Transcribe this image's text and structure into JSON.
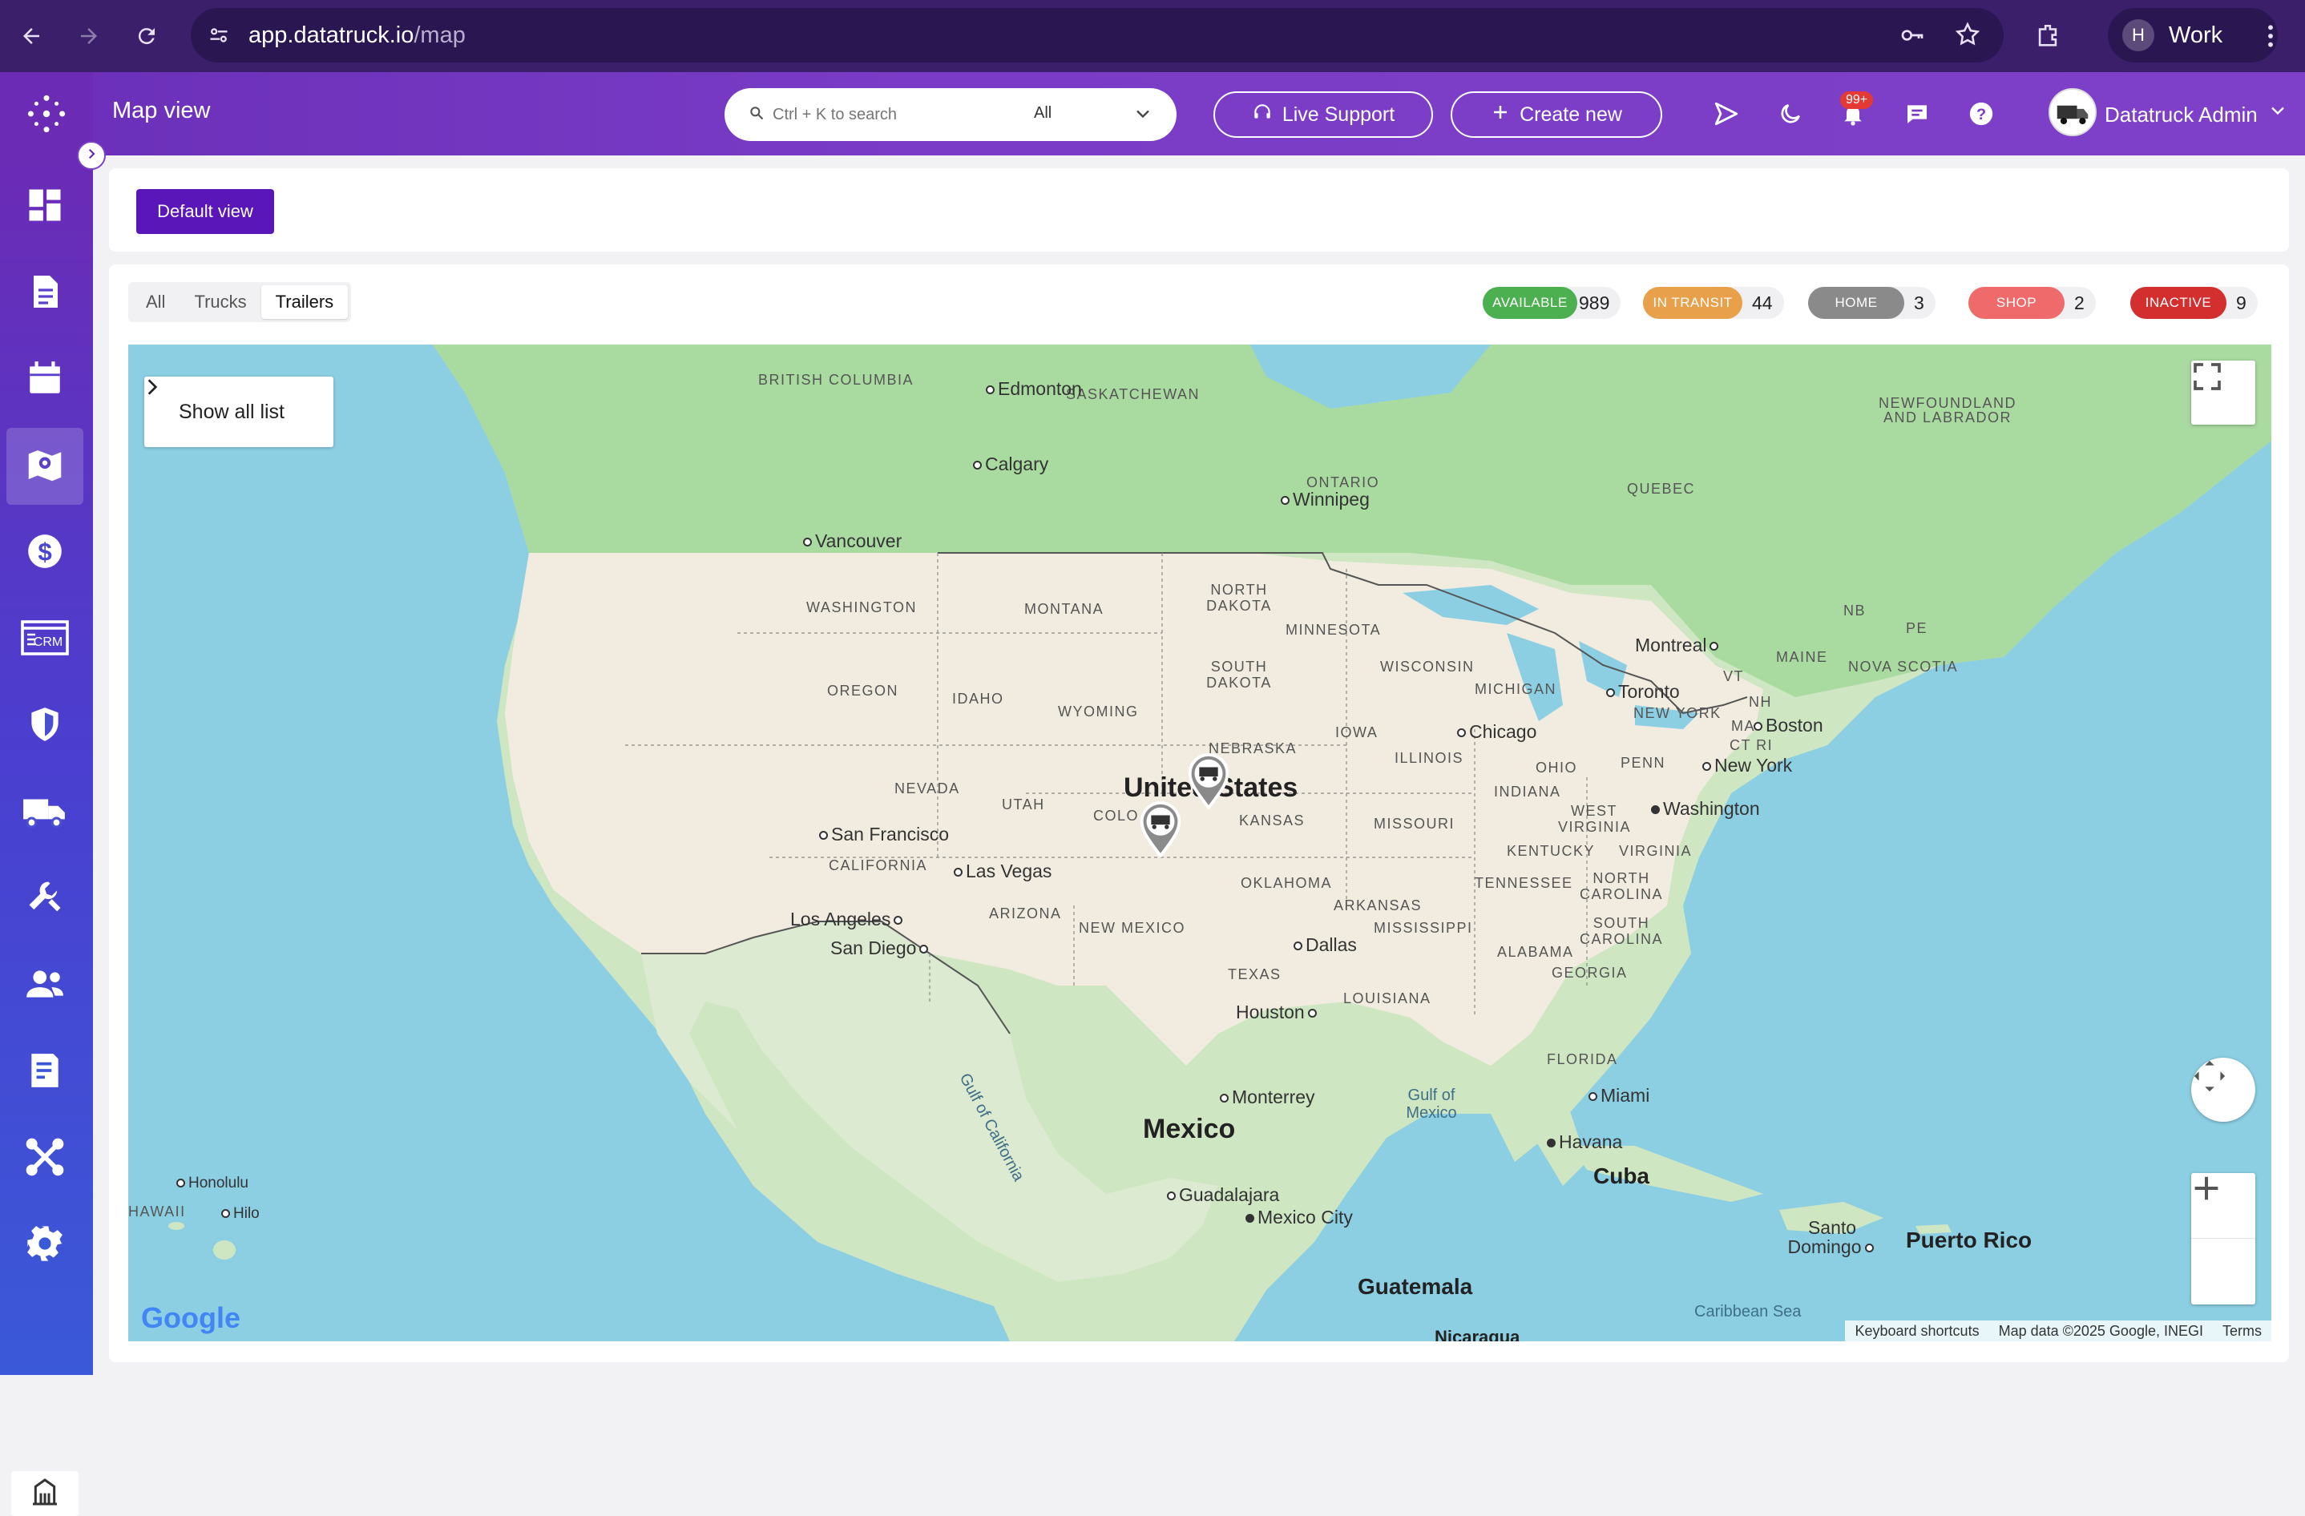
{
  "browser": {
    "url_host": "app.datatruck.io",
    "url_path": "/map",
    "profile_initial": "H",
    "profile_name": "Work"
  },
  "header": {
    "page_title": "Map view",
    "search_placeholder": "Ctrl + K to search",
    "search_scope": "All",
    "live_support": "Live Support",
    "create_new": "Create new",
    "notification_count": "99+",
    "user_name": "Datatruck Admin"
  },
  "sidebar": {
    "items": [
      "dashboard-icon",
      "document-icon",
      "calendar-icon",
      "map-icon",
      "dollar-icon",
      "crm-icon",
      "shield-icon",
      "truck-icon",
      "tools-icon",
      "users-icon",
      "report-icon",
      "integrations-icon",
      "settings-icon"
    ],
    "active": "map-icon",
    "crm_text": "CRM"
  },
  "toolbar": {
    "default_view": "Default view"
  },
  "tabs": [
    {
      "label": "All",
      "active": false
    },
    {
      "label": "Trucks",
      "active": false
    },
    {
      "label": "Trailers",
      "active": true
    }
  ],
  "statuses": [
    {
      "label": "AVAILABLE",
      "count": "989",
      "color": "#4caf50"
    },
    {
      "label": "IN TRANSIT",
      "count": "44",
      "color": "#e8a04a"
    },
    {
      "label": "HOME",
      "count": "3",
      "color": "#8a8a8a"
    },
    {
      "label": "SHOP",
      "count": "2",
      "color": "#ef6b6b"
    },
    {
      "label": "INACTIVE",
      "count": "9",
      "color": "#d32f2f"
    }
  ],
  "map": {
    "show_all_list": "Show all list",
    "google": "Google",
    "footer": [
      "Keyboard shortcuts",
      "Map data ©2025 Google, INEGI",
      "Terms"
    ],
    "regions": [
      "BRITISH COLUMBIA",
      "SASKATCHEWAN",
      "NEWFOUNDLAND AND LABRADOR",
      "ONTARIO",
      "QUEBEC",
      "WASHINGTON",
      "MONTANA",
      "NORTH DAKOTA",
      "MINNESOTA",
      "OREGON",
      "IDAHO",
      "WYOMING",
      "SOUTH DAKOTA",
      "WISCONSIN",
      "MICHIGAN",
      "NEBRASKA",
      "IOWA",
      "ILLINOIS",
      "OHIO",
      "PENN",
      "NEVADA",
      "UTAH",
      "COLO",
      "KANSAS",
      "MISSOURI",
      "INDIANA",
      "WEST VIRGINIA",
      "VIRGINIA",
      "KENTUCKY",
      "CALIFORNIA",
      "ARIZONA",
      "NEW MEXICO",
      "OKLAHOMA",
      "ARKANSAS",
      "TENNESSEE",
      "NORTH CAROLINA",
      "MISSISSIPPI",
      "ALABAMA",
      "SOUTH CAROLINA",
      "GEORGIA",
      "TEXAS",
      "LOUISIANA",
      "FLORIDA",
      "MAINE",
      "NB",
      "PE",
      "NOVA SCOTIA",
      "VT",
      "NH",
      "MA",
      "CT RI",
      "NEW YORK",
      "HAWAII"
    ],
    "cities": [
      "Edmonton",
      "Calgary",
      "Winnipeg",
      "Vancouver",
      "Montreal",
      "Toronto",
      "Boston",
      "New York",
      "Chicago",
      "Washington",
      "San Francisco",
      "Las Vegas",
      "Los Angeles",
      "San Diego",
      "Dallas",
      "Houston",
      "Monterrey",
      "Miami",
      "Havana",
      "Guadalajara",
      "Mexico City",
      "Santo Domingo",
      "Honolulu",
      "Hilo"
    ],
    "countries": [
      "United States",
      "Mexico",
      "Cuba",
      "Puerto Rico",
      "Guatemala",
      "Nicaragua"
    ],
    "water": [
      "Gulf of Mexico",
      "Gulf of California",
      "Caribbean Sea"
    ]
  }
}
